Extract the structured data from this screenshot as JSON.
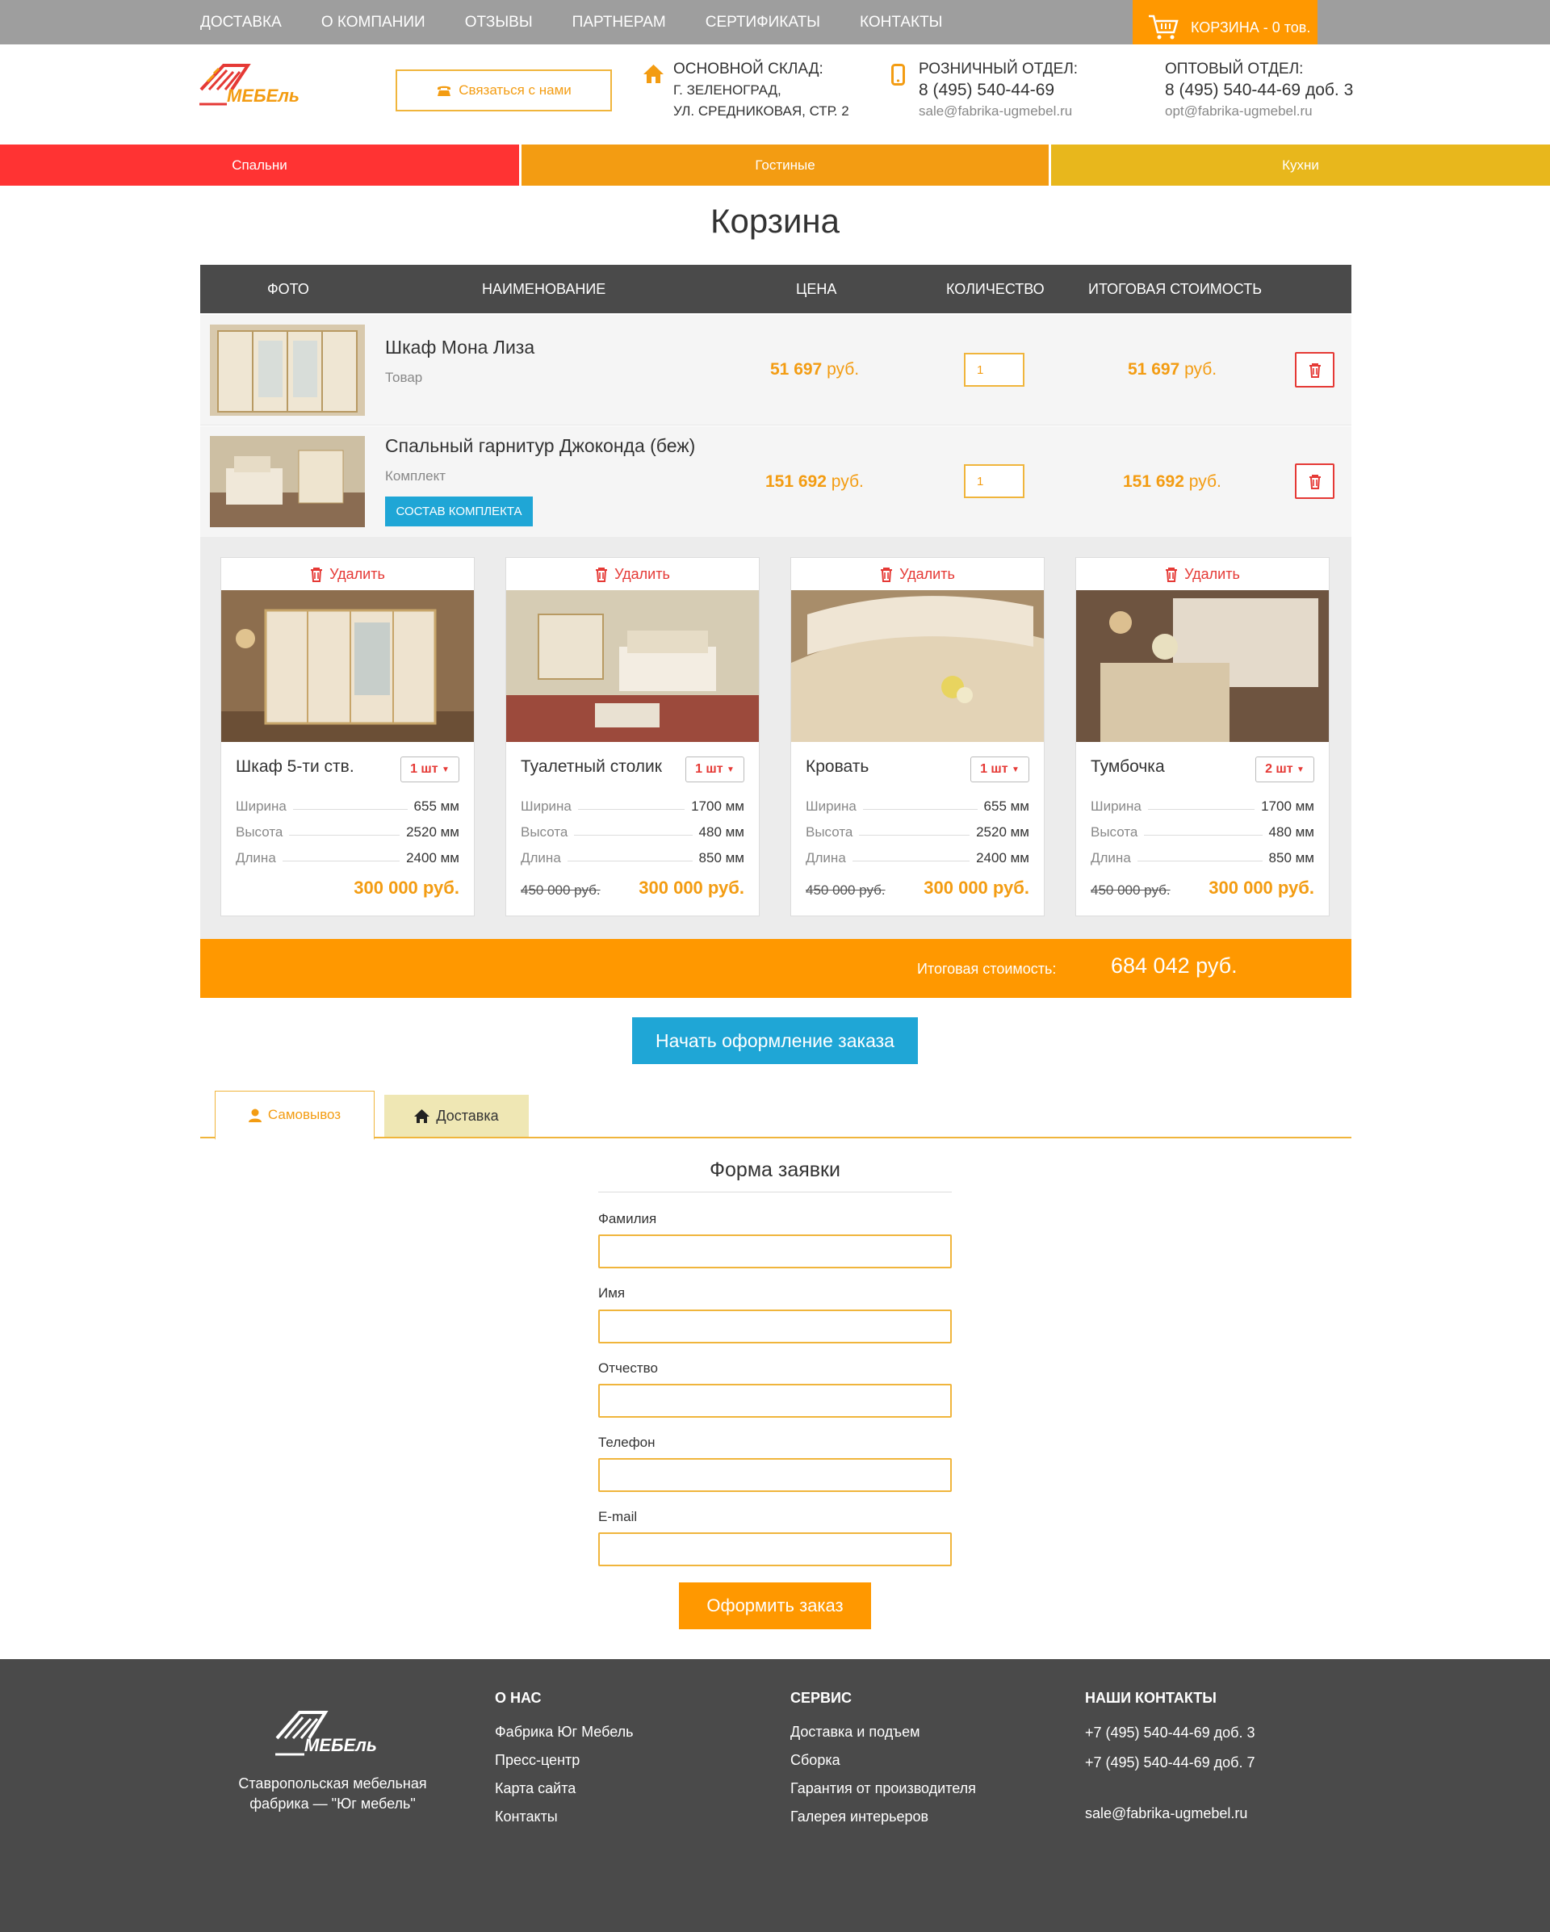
{
  "topnav": [
    "ДОСТАВКА",
    "О КОМПАНИИ",
    "ОТЗЫВЫ",
    "ПАРТНЕРАМ",
    "СЕРТИФИКАТЫ",
    "КОНТАКТЫ"
  ],
  "cart": {
    "label": "КОРЗИНА - 0 тов."
  },
  "logo": {
    "text": "МЕБЕль"
  },
  "header": {
    "contact_btn": "Связаться с нами",
    "warehouse": {
      "label": "ОСНОВНОЙ СКЛАД:",
      "line1": "Г. ЗЕЛЕНОГРАД,",
      "line2": "УЛ. СРЕДНИКОВАЯ, СТР. 2"
    },
    "retail": {
      "label": "РОЗНИЧНЫЙ ОТДЕЛ:",
      "phone": "8 (495) 540-44-69",
      "email": "sale@fabrika-ugmebel.ru"
    },
    "wholesale": {
      "label": "ОПТОВЫЙ ОТДЕЛ:",
      "phone": "8 (495) 540-44-69 доб. 3",
      "email": "opt@fabrika-ugmebel.ru"
    }
  },
  "categories": [
    "Спальни",
    "Гостиные",
    "Кухни"
  ],
  "page_title": "Корзина",
  "table": {
    "headers": [
      "ФОТО",
      "НАИМЕНОВАНИЕ",
      "ЦЕНА",
      "КОЛИЧЕСТВО",
      "ИТОГОВАЯ СТОИМОСТЬ"
    ],
    "rows": [
      {
        "name": "Шкаф Мона Лиза",
        "type": "Товар",
        "price": "51 697",
        "total": "51 697",
        "qty": "1"
      },
      {
        "name": "Спальный гарнитур Джоконда (беж)",
        "type": "Комплект",
        "price": "151 692",
        "total": "151 692",
        "qty": "1",
        "kit_btn": "СОСТАВ КОМПЛЕКТА"
      }
    ],
    "currency": "руб."
  },
  "kit": {
    "delete_label": "Удалить",
    "spec_labels": [
      "Ширина",
      "Высота",
      "Длина"
    ],
    "items": [
      {
        "name": "Шкаф 5-ти ств.",
        "qty": "1 шт",
        "width": "655 мм",
        "height": "2520 мм",
        "length": "2400 мм",
        "old_price": "",
        "price": "300 000 руб."
      },
      {
        "name": "Туалетный столик",
        "qty": "1 шт",
        "width": "1700 мм",
        "height": "480 мм",
        "length": "850 мм",
        "old_price": "450 000 руб.",
        "price": "300 000 руб."
      },
      {
        "name": "Кровать",
        "qty": "1 шт",
        "width": "655 мм",
        "height": "2520 мм",
        "length": "2400 мм",
        "old_price": "450 000 руб.",
        "price": "300 000 руб."
      },
      {
        "name": "Тумбочка",
        "qty": "2 шт",
        "width": "1700 мм",
        "height": "480 мм",
        "length": "850 мм",
        "old_price": "450 000 руб.",
        "price": "300 000 руб."
      }
    ]
  },
  "total": {
    "label": "Итоговая стоимость:",
    "value": "684 042 руб."
  },
  "start_btn": "Начать оформление заказа",
  "tabs": [
    "Самовывоз",
    "Доставка"
  ],
  "form": {
    "title": "Форма заявки",
    "fields": [
      "Фамилия",
      "Имя",
      "Отчество",
      "Телефон",
      "E-mail"
    ],
    "submit": "Оформить заказ"
  },
  "footer": {
    "tagline_1": "Ставропольская мебельная",
    "tagline_2": "фабрика — \"Юг мебель\"",
    "about": {
      "title": "О НАС",
      "links": [
        "Фабрика Юг Мебель",
        "Пресс-центр",
        "Карта сайта",
        "Контакты"
      ]
    },
    "service": {
      "title": "СЕРВИС",
      "links": [
        "Доставка и подъем",
        "Сборка",
        "Гарантия от производителя",
        "Галерея интерьеров"
      ]
    },
    "contacts": {
      "title": "НАШИ КОНТАКТЫ",
      "phone1": "+7 (495) 540-44-69",
      "ext1": "доб. 3",
      "phone2": "+7 (495) 540-44-69",
      "ext2": "доб. 7",
      "email": "sale@fabrika-ugmebel.ru"
    }
  },
  "colors": {
    "orange": "#ff9800",
    "red": "#ff3333",
    "yellow": "#e8b71c",
    "blue": "#1fa6d6",
    "dark": "#4a4a4a",
    "grey": "#9e9e9e"
  }
}
